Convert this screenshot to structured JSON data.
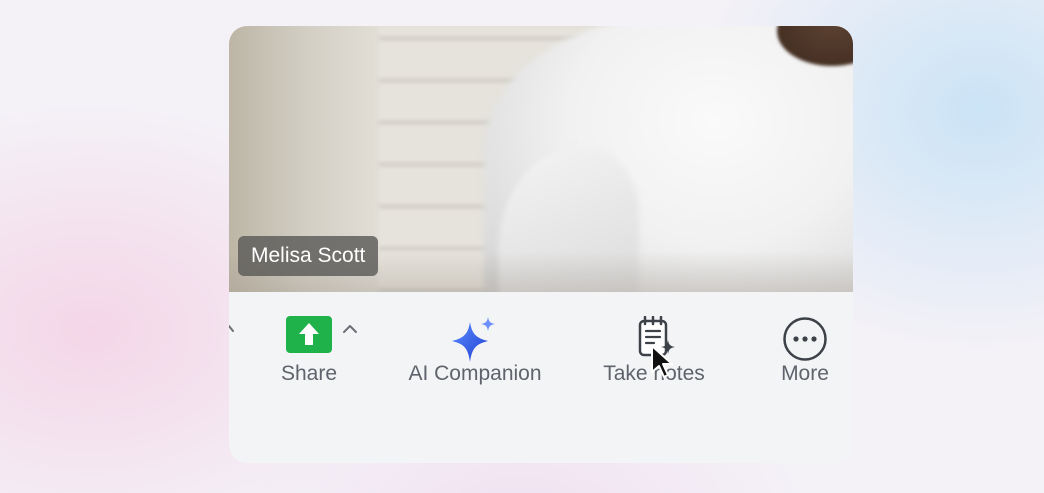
{
  "participant": {
    "name": "Melisa Scott"
  },
  "toolbar": {
    "share": {
      "label": "Share",
      "icon": "share-up-arrow-icon",
      "color": "#1fb24a"
    },
    "ai_companion": {
      "label": "AI Companion",
      "icon": "sparkle-icon",
      "color": "#2e55e6"
    },
    "take_notes": {
      "label": "Take notes",
      "icon": "notes-sparkle-icon"
    },
    "more": {
      "label": "More",
      "icon": "ellipsis-circle-icon"
    }
  },
  "colors": {
    "toolbar_bg": "#f3f4f6",
    "label_text": "#5f636b",
    "name_tag_bg": "#5c5a58"
  }
}
